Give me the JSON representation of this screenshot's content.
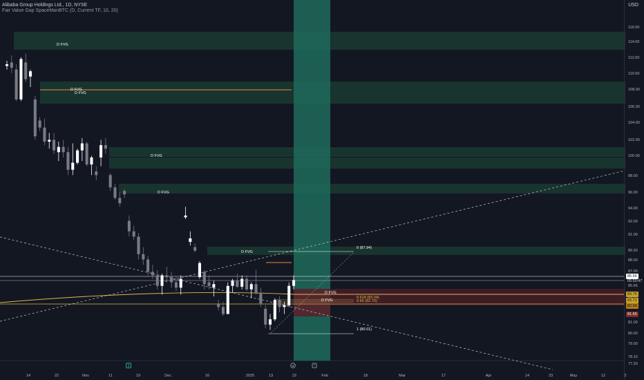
{
  "header": {
    "title": "Alibaba Group Holdings Ltd., 1D, NYSE",
    "indicator": "Fair Value Gap SpaceManBTC (D, Current TF, 10, 20)",
    "currency": "USD"
  },
  "y_axis": {
    "ticks": [
      "116.00",
      "114.00",
      "112.00",
      "110.00",
      "108.00",
      "106.00",
      "104.00",
      "102.00",
      "100.00",
      "98.00",
      "96.00",
      "94.00",
      "92.00",
      "91.00",
      "89.50",
      "88.00",
      "87.00",
      "86.00",
      "85.66",
      "83.00",
      "81.00",
      "80.00",
      "79.00",
      "78.10",
      "77.20"
    ]
  },
  "x_axis": {
    "ticks": [
      "14",
      "22",
      "Nov",
      "11",
      "19",
      "Dec",
      "16",
      "2025",
      "13",
      "22",
      "Feb",
      "18",
      "Mar",
      "17",
      "Apr",
      "14",
      "23",
      "May",
      "12",
      "2"
    ]
  },
  "fvg_labels": [
    "D FVG",
    "D FVG",
    "D FVG",
    "D FVG",
    "D FVG",
    "D FVG",
    "D FVG",
    "D FVG"
  ],
  "fib_labels": {
    "top": "0 (87.94)",
    "mid1": "0.618 (83.04)",
    "mid2": "0.66 (82.70)",
    "bottom": "1 (80.01)"
  },
  "price_tags": {
    "last_price": "85.66",
    "countdown": "05:50:47",
    "tag1": "83.75",
    "tag2": "83.72",
    "tag3": "82.68",
    "tag4": "81.65"
  },
  "colors": {
    "background": "#131722",
    "fvg_green": "#1e4d3a",
    "fvg_red": "#5a1f2a",
    "candle_up": "#ffffff",
    "candle_down": "#787b86",
    "highlight_column": "#1f6b5a",
    "gold": "#e5b84b",
    "orange": "#f0883e"
  },
  "chart_data": {
    "type": "candlestick",
    "title": "Alibaba Group Holdings Ltd., 1D, NYSE",
    "ylim": [
      76.5,
      117.5
    ],
    "candles": [
      [
        110.0,
        110.6,
        109.6,
        110.2
      ],
      [
        110.4,
        111.2,
        109.2,
        109.8
      ],
      [
        109.6,
        110.2,
        106.0,
        106.2
      ],
      [
        106.2,
        111.0,
        106.0,
        110.8
      ],
      [
        110.4,
        111.4,
        108.2,
        108.5
      ],
      [
        108.8,
        109.6,
        107.6,
        109.4
      ],
      [
        106.2,
        106.6,
        101.6,
        102.0
      ],
      [
        103.8,
        104.2,
        102.6,
        103.0
      ],
      [
        103.0,
        104.0,
        101.0,
        101.4
      ],
      [
        101.4,
        102.4,
        100.6,
        101.6
      ],
      [
        101.6,
        102.4,
        100.0,
        100.4
      ],
      [
        100.2,
        101.4,
        99.2,
        100.8
      ],
      [
        100.8,
        101.6,
        99.6,
        100.2
      ],
      [
        100.2,
        100.8,
        97.6,
        98.2
      ],
      [
        98.2,
        101.2,
        97.6,
        99.0
      ],
      [
        99.0,
        100.6,
        98.8,
        100.4
      ],
      [
        100.4,
        101.8,
        99.2,
        101.2
      ],
      [
        101.2,
        101.4,
        98.6,
        98.8
      ],
      [
        98.8,
        99.8,
        97.6,
        99.6
      ],
      [
        98.0,
        98.6,
        97.0,
        97.6
      ],
      [
        99.6,
        101.6,
        98.6,
        101.0
      ],
      [
        101.0,
        101.8,
        100.0,
        100.6
      ],
      [
        97.6,
        97.8,
        95.8,
        96.2
      ],
      [
        96.2,
        96.6,
        94.8,
        95.0
      ],
      [
        95.0,
        95.6,
        94.0,
        94.4
      ],
      [
        95.8,
        96.0,
        95.0,
        95.4
      ],
      [
        92.4,
        93.0,
        90.6,
        91.2
      ],
      [
        91.2,
        91.8,
        90.2,
        90.6
      ],
      [
        90.6,
        91.0,
        88.0,
        88.6
      ],
      [
        88.6,
        89.4,
        87.4,
        88.0
      ],
      [
        88.0,
        88.4,
        86.2,
        86.6
      ],
      [
        86.6,
        87.4,
        85.8,
        86.2
      ],
      [
        86.2,
        86.8,
        84.6,
        85.0
      ],
      [
        85.0,
        86.4,
        84.0,
        86.2
      ],
      [
        86.2,
        87.2,
        85.4,
        86.0
      ],
      [
        86.0,
        86.6,
        84.8,
        85.4
      ],
      [
        85.4,
        86.0,
        84.4,
        84.8
      ],
      [
        84.8,
        86.2,
        84.0,
        85.8
      ],
      [
        92.8,
        94.0,
        92.6,
        93.0
      ],
      [
        90.0,
        91.2,
        89.6,
        90.4
      ],
      [
        89.4,
        89.8,
        88.8,
        89.0
      ],
      [
        86.0,
        87.8,
        85.8,
        87.6
      ],
      [
        86.6,
        86.8,
        84.6,
        85.2
      ],
      [
        85.4,
        86.2,
        84.6,
        85.0
      ],
      [
        84.8,
        85.6,
        83.8,
        85.2
      ],
      [
        83.0,
        83.4,
        82.2,
        82.6
      ],
      [
        82.6,
        83.2,
        81.6,
        81.8
      ],
      [
        81.8,
        85.4,
        81.8,
        85.0
      ],
      [
        85.0,
        85.8,
        84.2,
        85.6
      ],
      [
        85.6,
        86.4,
        84.8,
        84.9
      ],
      [
        84.9,
        86.2,
        84.6,
        85.8
      ],
      [
        85.8,
        86.2,
        84.4,
        84.6
      ],
      [
        84.6,
        85.4,
        83.6,
        85.2
      ],
      [
        85.2,
        86.8,
        84.0,
        84.2
      ],
      [
        84.2,
        84.8,
        82.6,
        83.0
      ],
      [
        82.4,
        82.8,
        80.2,
        80.6
      ],
      [
        80.6,
        81.8,
        80.0,
        81.2
      ],
      [
        81.2,
        83.6,
        81.0,
        83.4
      ],
      [
        83.4,
        83.8,
        82.0,
        82.6
      ],
      [
        82.6,
        83.2,
        81.8,
        82.8
      ],
      [
        82.8,
        85.4,
        82.6,
        85.0
      ],
      [
        85.0,
        86.2,
        84.6,
        85.66
      ]
    ]
  }
}
